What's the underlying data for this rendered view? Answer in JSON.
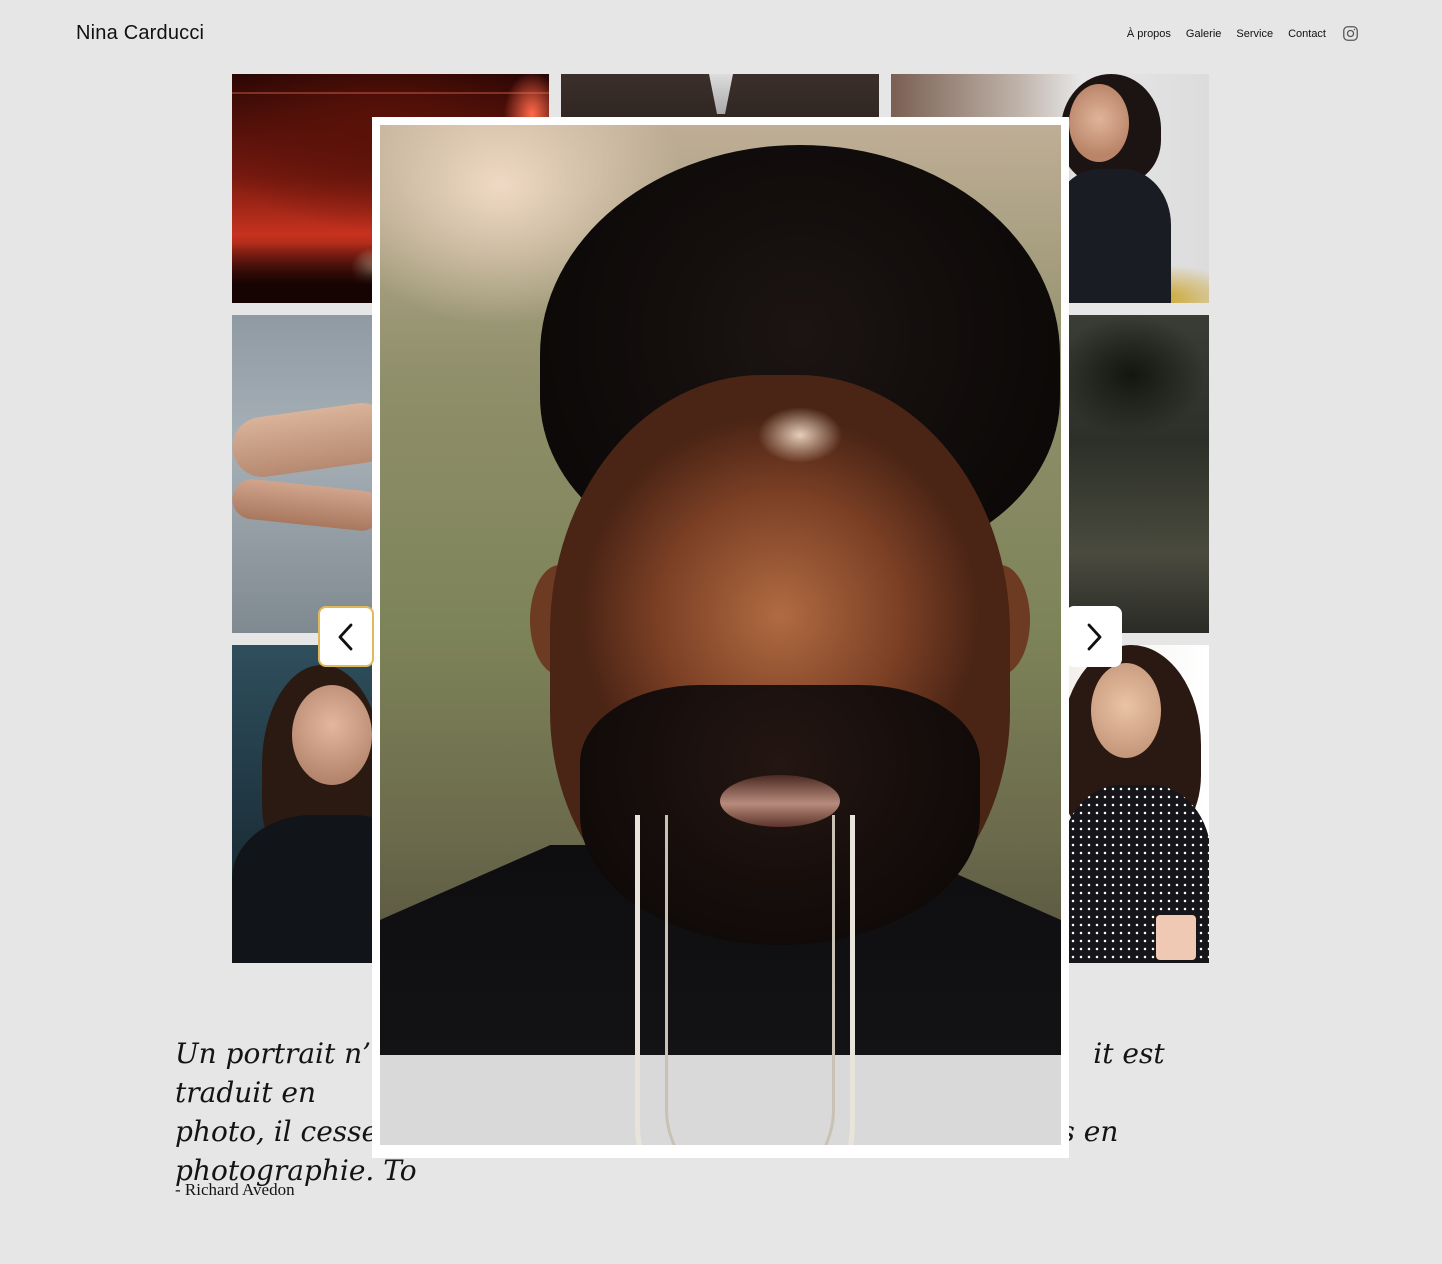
{
  "header": {
    "brand": "Nina Carducci",
    "nav": [
      {
        "label": "À propos"
      },
      {
        "label": "Galerie"
      },
      {
        "label": "Service"
      },
      {
        "label": "Contact"
      }
    ],
    "social_icon": "instagram-icon"
  },
  "gallery": {
    "tiles": [
      "concert",
      "portrait-suit",
      "portrait-woman-smiling",
      "hands",
      "palm-trees",
      "portrait-glasses",
      "portrait-woman-laughing"
    ]
  },
  "lightbox": {
    "image": "portrait-man-eyes-closed",
    "prev_icon": "chevron-left-icon",
    "next_icon": "chevron-right-icon"
  },
  "quote": {
    "line1_start": "Un portrait n’est",
    "line1_end": "it est traduit en",
    "line2_start": "photo, il cesse d’e",
    "line2_end": "e pas en",
    "line3_start": "photographie. To",
    "author": "- Richard Avedon"
  },
  "colors": {
    "background": "#e6e6e7",
    "accent_focus": "#e2b95a"
  }
}
